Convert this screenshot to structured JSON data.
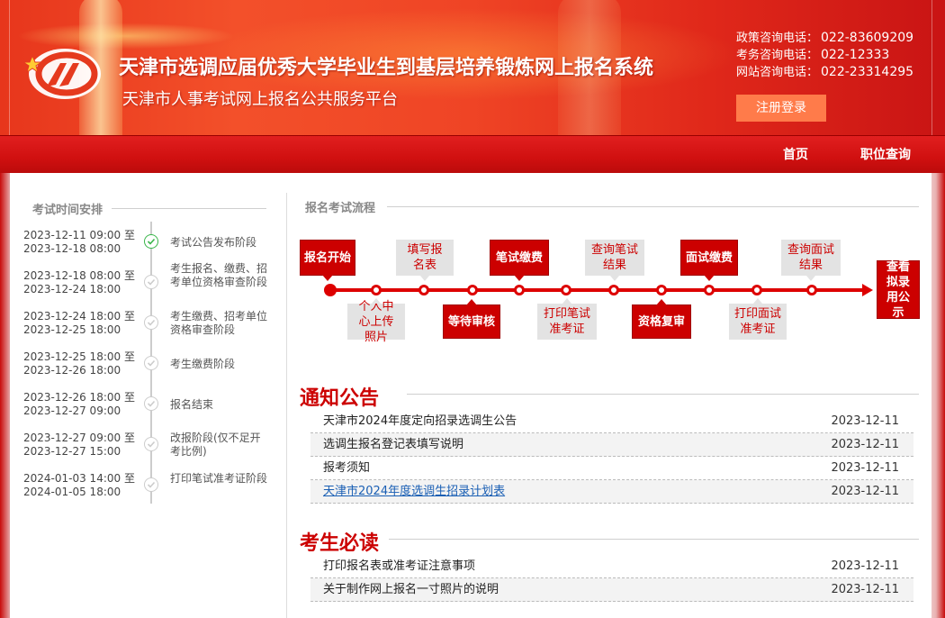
{
  "header": {
    "title": "天津市选调应届优秀大学毕业生到基层培养锻炼网上报名系统",
    "subtitle": "天津市人事考试网上报名公共服务平台",
    "phones": [
      {
        "label": "政策咨询电话：",
        "number": "022-83609209"
      },
      {
        "label": "考务咨询电话：",
        "number": "022-12333"
      },
      {
        "label": "网站咨询电话：",
        "number": "022-23314295"
      }
    ],
    "login_label": "注册登录"
  },
  "nav": {
    "home": "首页",
    "position_query": "职位查询"
  },
  "schedule": {
    "title": "考试时间安排",
    "items": [
      {
        "start": "2023-12-11 09:00 至",
        "end": "2023-12-18 08:00",
        "text": "考试公告发布阶段",
        "active": true
      },
      {
        "start": "2023-12-18 08:00 至",
        "end": "2023-12-24 18:00",
        "text": "考生报名、缴费、招考单位资格审查阶段",
        "active": false
      },
      {
        "start": "2023-12-24 18:00 至",
        "end": "2023-12-25 18:00",
        "text": "考生缴费、招考单位资格审查阶段",
        "active": false
      },
      {
        "start": "2023-12-25 18:00 至",
        "end": "2023-12-26 18:00",
        "text": "考生缴费阶段",
        "active": false
      },
      {
        "start": "2023-12-26 18:00 至",
        "end": "2023-12-27 09:00",
        "text": "报名结束",
        "active": false
      },
      {
        "start": "2023-12-27 09:00 至",
        "end": "2023-12-27 15:00",
        "text": "改报阶段(仅不足开考比例)",
        "active": false
      },
      {
        "start": "2024-01-03 14:00 至",
        "end": "2024-01-05 18:00",
        "text": "打印笔试准考证阶段",
        "active": false
      }
    ]
  },
  "flow": {
    "title": "报名考试流程",
    "steps": {
      "start": "报名开始",
      "fill_form": "填写报名表",
      "written_fee": "笔试缴费",
      "query_written": "查询笔试结果",
      "interview_fee": "面试缴费",
      "query_interview": "查询面试结果",
      "view_hire": "查看拟录用公示",
      "personal_photo": "个人中心上传照片",
      "wait_review": "等待审核",
      "print_written": "打印笔试准考证",
      "recheck": "资格复审",
      "print_interview": "打印面试准考证"
    }
  },
  "notices": {
    "title": "通知公告",
    "items": [
      {
        "title": "天津市2024年度定向招录选调生公告",
        "date": "2023-12-11",
        "link": false
      },
      {
        "title": "选调生报名登记表填写说明",
        "date": "2023-12-11",
        "link": false
      },
      {
        "title": "报考须知",
        "date": "2023-12-11",
        "link": false
      },
      {
        "title": "天津市2024年度选调生招录计划表",
        "date": "2023-12-11",
        "link": true
      }
    ]
  },
  "must_read": {
    "title": "考生必读",
    "items": [
      {
        "title": "打印报名表或准考证注意事项",
        "date": "2023-12-11"
      },
      {
        "title": "关于制作网上报名一寸照片的说明",
        "date": "2023-12-11"
      }
    ]
  }
}
